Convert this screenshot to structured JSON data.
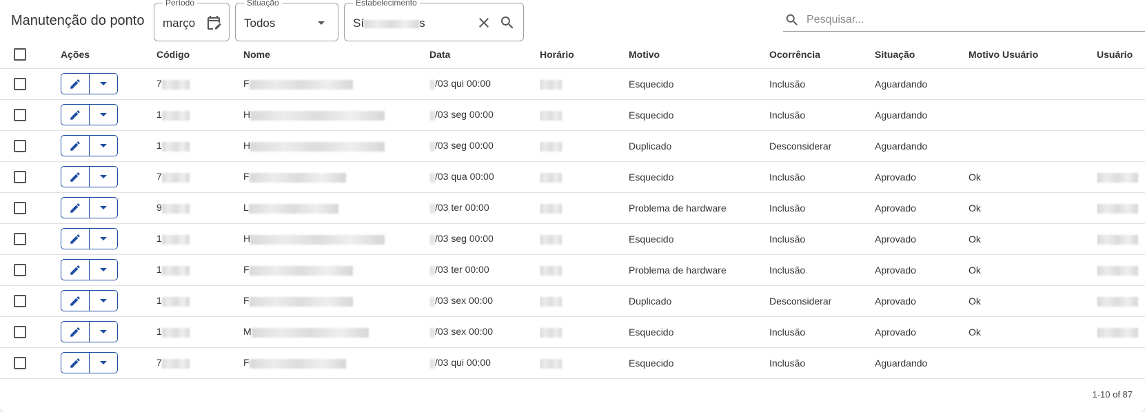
{
  "page": {
    "title": "Manutenção do ponto"
  },
  "filters": {
    "periodo": {
      "label": "Período",
      "value": "março",
      "icon": "calendar-edit-icon"
    },
    "situacao": {
      "label": "Situação",
      "value": "Todos",
      "icon": "chevron-down-icon"
    },
    "estabelecimento": {
      "label": "Estabelecimento",
      "value_prefix": "Sí",
      "value_suffix": "s",
      "clear_icon": "close-icon",
      "search_icon": "search-icon"
    }
  },
  "search": {
    "placeholder": "Pesquisar...",
    "icon": "search-icon"
  },
  "table": {
    "columns": [
      "Ações",
      "Código",
      "Nome",
      "Data",
      "Horário",
      "Motivo",
      "Ocorrência",
      "Situação",
      "Motivo Usuário",
      "Usuário"
    ],
    "rows": [
      {
        "codigo": "7",
        "nome": "F",
        "data": "/03 qui 00:00",
        "motivo": "Esquecido",
        "ocorrencia": "Inclusão",
        "situacao": "Aguardando",
        "motivo_usuario": "",
        "has_usuario": false
      },
      {
        "codigo": "1",
        "nome": "H",
        "data": "/03 seg 00:00",
        "motivo": "Esquecido",
        "ocorrencia": "Inclusão",
        "situacao": "Aguardando",
        "motivo_usuario": "",
        "has_usuario": false
      },
      {
        "codigo": "1",
        "nome": "H",
        "data": "/03 seg 00:00",
        "motivo": "Duplicado",
        "ocorrencia": "Desconsiderar",
        "situacao": "Aguardando",
        "motivo_usuario": "",
        "has_usuario": false
      },
      {
        "codigo": "7",
        "nome": "F",
        "data": "/03 qua 00:00",
        "motivo": "Esquecido",
        "ocorrencia": "Inclusão",
        "situacao": "Aprovado",
        "motivo_usuario": "Ok",
        "has_usuario": true
      },
      {
        "codigo": "9",
        "nome": "L",
        "data": "/03 ter 00:00",
        "motivo": "Problema de hardware",
        "ocorrencia": "Inclusão",
        "situacao": "Aprovado",
        "motivo_usuario": "Ok",
        "has_usuario": true
      },
      {
        "codigo": "1",
        "nome": "H",
        "data": "/03 seg 00:00",
        "motivo": "Esquecido",
        "ocorrencia": "Inclusão",
        "situacao": "Aprovado",
        "motivo_usuario": "Ok",
        "has_usuario": true
      },
      {
        "codigo": "1",
        "nome": "F",
        "data": "/03 ter 00:00",
        "motivo": "Problema de hardware",
        "ocorrencia": "Inclusão",
        "situacao": "Aprovado",
        "motivo_usuario": "Ok",
        "has_usuario": true
      },
      {
        "codigo": "1",
        "nome": "F",
        "data": "/03 sex 00:00",
        "motivo": "Duplicado",
        "ocorrencia": "Desconsiderar",
        "situacao": "Aprovado",
        "motivo_usuario": "Ok",
        "has_usuario": true
      },
      {
        "codigo": "1",
        "nome": "M",
        "data": "/03 sex 00:00",
        "motivo": "Esquecido",
        "ocorrencia": "Inclusão",
        "situacao": "Aprovado",
        "motivo_usuario": "Ok",
        "has_usuario": true
      },
      {
        "codigo": "7",
        "nome": "F",
        "data": "/03 qui 00:00",
        "motivo": "Esquecido",
        "ocorrencia": "Inclusão",
        "situacao": "Aguardando",
        "motivo_usuario": "",
        "has_usuario": false
      }
    ],
    "row_action_icons": {
      "edit": "pencil-icon",
      "menu": "chevron-down-icon"
    }
  },
  "pagination": {
    "label": "1-10 of 87"
  },
  "colors": {
    "accent": "#1d4fa3",
    "divider": "#e0e0e0"
  }
}
